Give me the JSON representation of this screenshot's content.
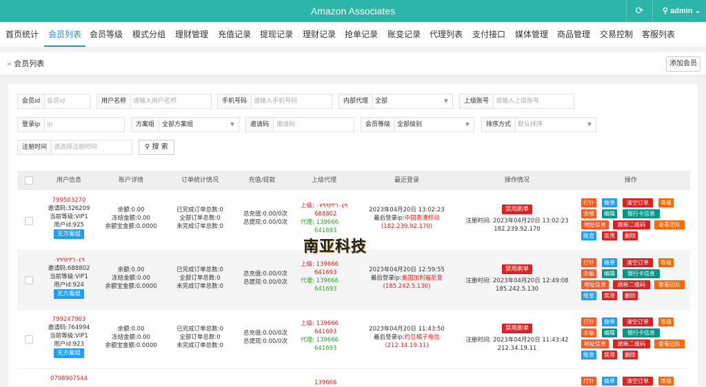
{
  "app": {
    "title": "Amazon Associates",
    "refresh_icon": "refresh-icon",
    "user": "admin",
    "user_icon": "user-icon"
  },
  "nav": {
    "items": [
      "首页统计",
      "会员列表",
      "会员等级",
      "模式分组",
      "理财管理",
      "充值记录",
      "提现记录",
      "理财记录",
      "抢单记录",
      "账变记录",
      "代理列表",
      "支付接口",
      "媒体管理",
      "商品管理",
      "交易控制",
      "客服列表"
    ],
    "active": 1
  },
  "breadcrumb": {
    "prefix": "»",
    "label": "会员列表",
    "add_button": "添加会员"
  },
  "filters": {
    "member_id": {
      "label": "会员id",
      "placeholder": "会员id"
    },
    "username": {
      "label": "用户名称",
      "placeholder": "请输入用户名称"
    },
    "phone": {
      "label": "手机号码",
      "placeholder": "请输入手机号码"
    },
    "internal_agent": {
      "label": "内部代理",
      "value": "全部"
    },
    "superior": {
      "label": "上级账号",
      "placeholder": "请输入上级账号"
    },
    "login_ip": {
      "label": "登录ip",
      "placeholder": "ip"
    },
    "scheme": {
      "label": "方案组",
      "value": "全部方案组"
    },
    "invite": {
      "label": "邀请码",
      "placeholder": "邀请码"
    },
    "level": {
      "label": "会员等级",
      "value": "全部级别"
    },
    "sort": {
      "label": "排序方式",
      "value": "默认排序"
    },
    "reg_time": {
      "label": "注册时间",
      "placeholder": "请选择注册时间"
    },
    "search_button": "搜 索"
  },
  "table": {
    "headers": [
      "用户信息",
      "账户详情",
      "订单统计情况",
      "充值/提款",
      "上级代理",
      "最近登录",
      "操作情况",
      "操作"
    ],
    "rows": [
      {
        "user": {
          "phone": "799503270",
          "invite": "邀请码:326209",
          "level": "当前等级:VIP1",
          "uid": "用户id:925",
          "group": "无方案组"
        },
        "account": [
          "余额:0.00",
          "冻结金额:0.00",
          "余额宝金额:0.0000"
        ],
        "orders": [
          "已完成订单总数:0",
          "全部订单总数:0",
          "未完成订单总数:0"
        ],
        "funds": [
          "总充值:0.00/0次",
          "总提现:0.00/0次"
        ],
        "agent": {
          "sup_label": "上级:",
          "sup_val": "٠٧٩٩٢٣٦٠٤٩",
          "sup_val2": "688802",
          "agent_label": "代理:",
          "agent_val": "139666",
          "agent_val2": "641693"
        },
        "login": {
          "time": "2023年04月20日 13:02:23",
          "ip_label": "最后登录ip:",
          "ip_loc": "中国香港移动",
          "ip": "(182.239.92.170)"
        },
        "status": {
          "badge": "禁用刷单",
          "reg_label": "注册时间:",
          "reg_time": "2023年04月20日 13:02:23",
          "reg_ip": "182.239.92.170"
        }
      },
      {
        "user": {
          "phone": "٠٧٩٩٢٣٦٠٤٩",
          "invite": "邀请码:688802",
          "level": "当前等级:VIP1",
          "uid": "用户id:924",
          "group": "无方案组"
        },
        "account": [
          "余额:0.00",
          "冻结金额:0.00",
          "余额宝金额:0.0000"
        ],
        "orders": [
          "已完成订单总数:0",
          "全部订单总数:0",
          "未完成订单总数:0"
        ],
        "funds": [
          "总充值:0.00/0次",
          "总提现:0.00/0次"
        ],
        "agent": {
          "sup_label": "上级:",
          "sup_val": "139666",
          "sup_val2": "641693",
          "agent_label": "代理:",
          "agent_val": "139666",
          "agent_val2": "641693"
        },
        "login": {
          "time": "2023年04月20日 12:59:55",
          "ip_label": "最后登录ip:",
          "ip_loc": "美国加利福尼亚",
          "ip": "(185.242.5.130)"
        },
        "status": {
          "badge": "禁用刷单",
          "reg_label": "注册时间:",
          "reg_time": "2023年04月20日 12:49:08",
          "reg_ip": "185.242.5.130"
        }
      },
      {
        "user": {
          "phone": "799247903",
          "invite": "邀请码:764994",
          "level": "当前等级:VIP1",
          "uid": "用户id:923",
          "group": "无方案组"
        },
        "account": [
          "余额:0.00",
          "冻结金额:0.00",
          "余额宝金额:0.0000"
        ],
        "orders": [
          "已完成订单总数:0",
          "全部订单总数:0",
          "未完成订单总数:0"
        ],
        "funds": [
          "总充值:0.00/0次",
          "总提现:0.00/0次"
        ],
        "agent": {
          "sup_label": "上级:",
          "sup_val": "139666",
          "sup_val2": "641693",
          "agent_label": "代理:",
          "agent_val": "139666",
          "agent_val2": "641693"
        },
        "login": {
          "time": "2023年04月20日 11:43:50",
          "ip_label": "最后登录ip:",
          "ip_loc": "约旦橘子电信",
          "ip": "(212.34.19.11)"
        },
        "status": {
          "badge": "禁用刷单",
          "reg_label": "注册时间:",
          "reg_time": "2023年04月20日 11:43:42",
          "reg_ip": "212.34.19.11"
        }
      },
      {
        "user": {
          "phone": "0798907544"
        },
        "agent": {
          "sup_val": "139666"
        }
      }
    ],
    "op_buttons": [
      "打针",
      "做单",
      "清空订单",
      "等级",
      "余额",
      "编辑",
      "银行卡信息",
      "地址信息",
      "刷新二维码",
      "查看团队",
      "账变",
      "禁用",
      "删除"
    ]
  },
  "watermark": "南亚科技",
  "colors": {
    "header": "#2cb5a9",
    "accent": "#2a8fbd",
    "blue": "#1e9fff",
    "red": "#e02020",
    "green": "#2aa62a",
    "orange": "#ff5722"
  }
}
